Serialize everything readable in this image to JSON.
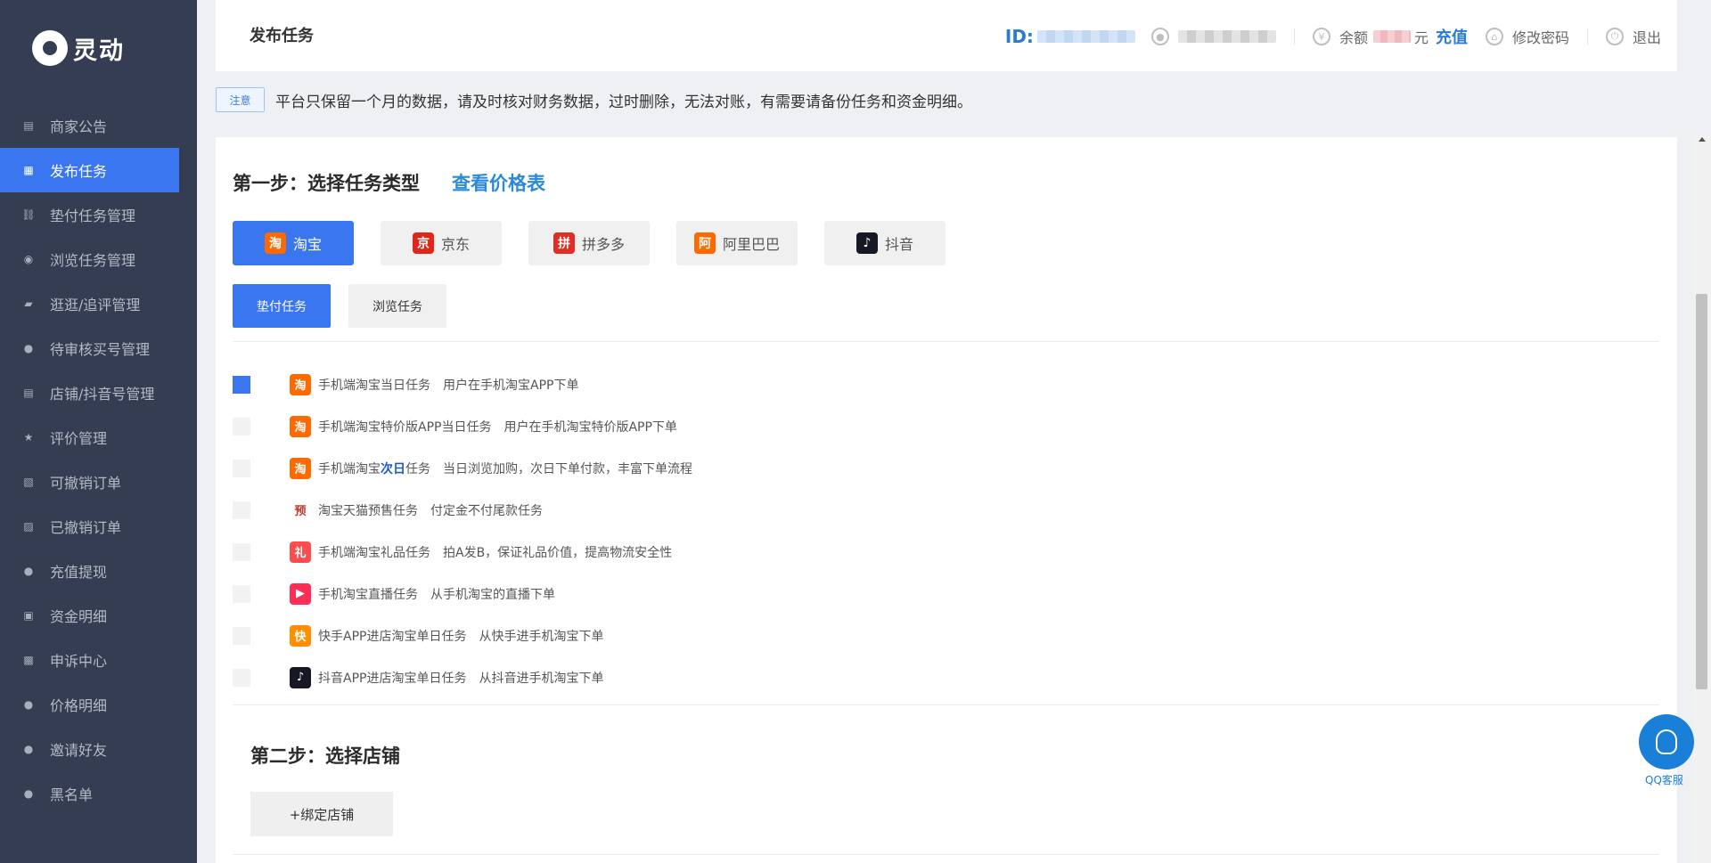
{
  "sidebar": {
    "logo_text": "灵动",
    "items": [
      {
        "label": "商家公告",
        "icon": "store-icon"
      },
      {
        "label": "发布任务",
        "icon": "document-icon",
        "active": true
      },
      {
        "label": "垫付任务管理",
        "icon": "link-icon"
      },
      {
        "label": "浏览任务管理",
        "icon": "eye-icon"
      },
      {
        "label": "逛逛/追评管理",
        "icon": "comment-icon"
      },
      {
        "label": "待审核买号管理",
        "icon": "user-icon"
      },
      {
        "label": "店铺/抖音号管理",
        "icon": "shop-icon"
      },
      {
        "label": "评价管理",
        "icon": "star-icon"
      },
      {
        "label": "可撤销订单",
        "icon": "file-icon"
      },
      {
        "label": "已撤销订单",
        "icon": "file-clock-icon"
      },
      {
        "label": "充值提现",
        "icon": "money-bag-icon"
      },
      {
        "label": "资金明细",
        "icon": "wallet-icon"
      },
      {
        "label": "申诉中心",
        "icon": "appeal-icon"
      },
      {
        "label": "价格明细",
        "icon": "price-icon"
      },
      {
        "label": "邀请好友",
        "icon": "user-add-icon"
      },
      {
        "label": "黑名单",
        "icon": "user-block-icon"
      }
    ]
  },
  "header": {
    "title": "发布任务",
    "id_label": "ID:",
    "balance_label": "余额",
    "balance_unit": "元",
    "recharge": "充值",
    "change_password": "修改密码",
    "logout": "退出"
  },
  "notice": {
    "tag": "注意",
    "text": "平台只保留一个月的数据，请及时核对财务数据，过时删除，无法对账，有需要请备份任务和资金明细。"
  },
  "step1": {
    "title": "第一步：选择任务类型",
    "price_link": "查看价格表",
    "platforms": [
      {
        "label": "淘宝",
        "icon": "taobao-icon",
        "color": "#ff6a00",
        "glyph": "淘",
        "active": true
      },
      {
        "label": "京东",
        "icon": "jd-icon",
        "color": "#e1251b",
        "glyph": "京"
      },
      {
        "label": "拼多多",
        "icon": "pdd-icon",
        "color": "#e02e24",
        "glyph": "拼"
      },
      {
        "label": "阿里巴巴",
        "icon": "alibaba-icon",
        "color": "#ff6a00",
        "glyph": "阿"
      },
      {
        "label": "抖音",
        "icon": "douyin-icon",
        "color": "#161823",
        "glyph": "♪"
      }
    ],
    "task_types": [
      {
        "label": "垫付任务",
        "active": true
      },
      {
        "label": "浏览任务"
      }
    ],
    "tasks": [
      {
        "name": "手机端淘宝当日任务",
        "desc": "用户在手机淘宝APP下单",
        "icon": "taobao-icon",
        "color": "#ff6a00",
        "glyph": "淘",
        "checked": true
      },
      {
        "name": "手机端淘宝特价版APP当日任务",
        "desc": "用户在手机淘宝特价版APP下单",
        "icon": "taobao-icon",
        "color": "#ff6a00",
        "glyph": "淘"
      },
      {
        "name_pre": "手机端淘宝",
        "name_hl": "次日",
        "name_post": "任务",
        "desc": "当日浏览加购，次日下单付款，丰富下单流程",
        "icon": "taobao-icon",
        "color": "#ff6a00",
        "glyph": "淘"
      },
      {
        "name": "淘宝天猫预售任务",
        "desc": "付定金不付尾款任务",
        "icon": "presale-icon",
        "color": "#ffffff",
        "glyph": "预"
      },
      {
        "name": "手机端淘宝礼品任务",
        "desc": "拍A发B，保证礼品价值，提高物流安全性",
        "icon": "gift-icon",
        "color": "#ff4d4f",
        "glyph": "礼"
      },
      {
        "name": "手机淘宝直播任务",
        "desc": "从手机淘宝的直播下单",
        "icon": "live-icon",
        "color": "#ff2d55",
        "glyph": "▶"
      },
      {
        "name": "快手APP进店淘宝单日任务",
        "desc": "从快手进手机淘宝下单",
        "icon": "kuaishou-icon",
        "color": "#ff8f00",
        "glyph": "快"
      },
      {
        "name": "抖音APP进店淘宝单日任务",
        "desc": "从抖音进手机淘宝下单",
        "icon": "douyin-icon",
        "color": "#161823",
        "glyph": "♪"
      }
    ]
  },
  "step2": {
    "title": "第二步：选择店铺",
    "bind_button": "+绑定店铺"
  },
  "qq_service": {
    "label": "QQ客服"
  }
}
